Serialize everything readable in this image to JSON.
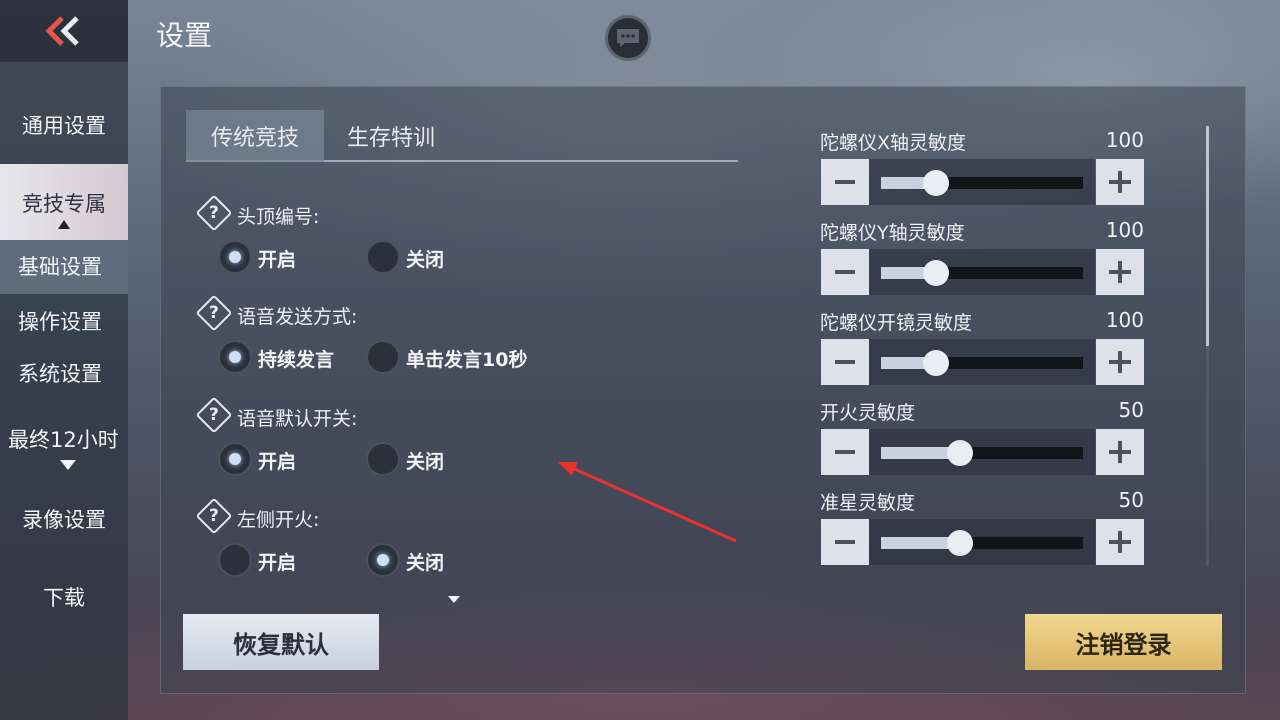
{
  "header": {
    "title": "设置"
  },
  "sidebar": {
    "items": [
      {
        "label": "通用设置"
      },
      {
        "label": "竞技专属"
      },
      {
        "label": "基础设置"
      },
      {
        "label": "操作设置"
      },
      {
        "label": "系统设置"
      },
      {
        "label": "最终12小时"
      },
      {
        "label": "录像设置"
      },
      {
        "label": "下载"
      }
    ]
  },
  "tabs": [
    {
      "label": "传统竞技",
      "active": true
    },
    {
      "label": "生存特训",
      "active": false
    }
  ],
  "options": [
    {
      "label": "头顶编号:",
      "choices": [
        "开启",
        "关闭"
      ],
      "selected": 0
    },
    {
      "label": "语音发送方式:",
      "choices": [
        "持续发言",
        "单击发言10秒"
      ],
      "selected": 0
    },
    {
      "label": "语音默认开关:",
      "choices": [
        "开启",
        "关闭"
      ],
      "selected": 0
    },
    {
      "label": "左侧开火:",
      "choices": [
        "开启",
        "关闭"
      ],
      "selected": 1
    }
  ],
  "sliders": [
    {
      "label": "陀螺仪X轴灵敏度",
      "value": "100",
      "level": 0.27
    },
    {
      "label": "陀螺仪Y轴灵敏度",
      "value": "100",
      "level": 0.27
    },
    {
      "label": "陀螺仪开镜灵敏度",
      "value": "100",
      "level": 0.27
    },
    {
      "label": "开火灵敏度",
      "value": "50",
      "level": 0.39
    },
    {
      "label": "准星灵敏度",
      "value": "50",
      "level": 0.39
    }
  ],
  "buttons": {
    "reset": "恢复默认",
    "logout": "注销登录"
  },
  "icons": {
    "back": "double-chevron-left-icon",
    "chat": "chat-bubble-icon",
    "help": "question-diamond-icon",
    "minus": "minus-icon",
    "plus": "plus-icon"
  },
  "colors": {
    "accent_back": "#e8554a",
    "logout_button": "#e6c77a",
    "active_tab": "#7884961"
  }
}
